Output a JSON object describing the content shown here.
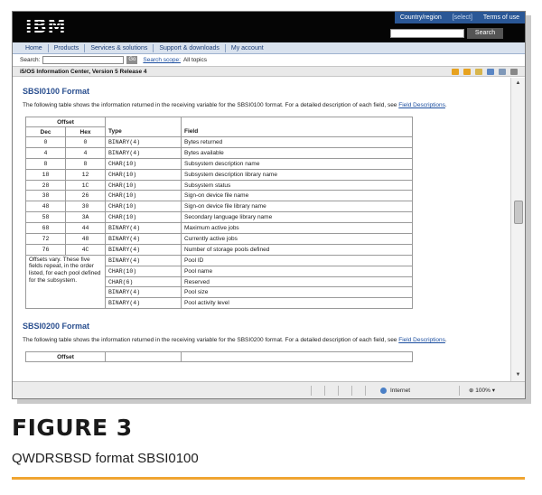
{
  "header": {
    "logo_text": "IBM",
    "links": [
      "Country/region",
      "[select]",
      "Terms of use"
    ],
    "search_button": "Search"
  },
  "nav": {
    "items": [
      "Home",
      "Products",
      "Services & solutions",
      "Support & downloads",
      "My account"
    ]
  },
  "search_bar": {
    "label": "Search:",
    "go_label": "Go",
    "scope_label": "Search scope:",
    "scope_value": "All topics"
  },
  "toolbar": {
    "breadcrumb": "i5/OS Information Center, Version 5 Release 4"
  },
  "section1": {
    "title": "SBSI0100 Format",
    "desc_text": "The following table shows the information returned in the receiving variable for the SBSI0100 format. For a detailed description of each field, see",
    "desc_link": "Field Descriptions",
    "desc_end": "."
  },
  "table": {
    "group_header": "Offset",
    "headers": [
      "Dec",
      "Hex",
      "Type",
      "Field"
    ],
    "rows": [
      {
        "dec": "0",
        "hex": "0",
        "type": "BINARY(4)",
        "field": "Bytes returned"
      },
      {
        "dec": "4",
        "hex": "4",
        "type": "BINARY(4)",
        "field": "Bytes available"
      },
      {
        "dec": "8",
        "hex": "8",
        "type": "CHAR(10)",
        "field": "Subsystem description name"
      },
      {
        "dec": "18",
        "hex": "12",
        "type": "CHAR(10)",
        "field": "Subsystem description library name"
      },
      {
        "dec": "28",
        "hex": "1C",
        "type": "CHAR(10)",
        "field": "Subsystem status"
      },
      {
        "dec": "38",
        "hex": "26",
        "type": "CHAR(10)",
        "field": "Sign-on device file name"
      },
      {
        "dec": "48",
        "hex": "30",
        "type": "CHAR(10)",
        "field": "Sign-on device file library name"
      },
      {
        "dec": "58",
        "hex": "3A",
        "type": "CHAR(10)",
        "field": "Secondary language library name"
      },
      {
        "dec": "68",
        "hex": "44",
        "type": "BINARY(4)",
        "field": "Maximum active jobs"
      },
      {
        "dec": "72",
        "hex": "48",
        "type": "BINARY(4)",
        "field": "Currently active jobs"
      },
      {
        "dec": "76",
        "hex": "4C",
        "type": "BINARY(4)",
        "field": "Number of storage pools defined"
      }
    ],
    "repeat_note": "Offsets vary. These five fields repeat, in the order listed, for each pool defined for the subsystem.",
    "repeat_rows": [
      {
        "type": "BINARY(4)",
        "field": "Pool ID"
      },
      {
        "type": "CHAR(10)",
        "field": "Pool name"
      },
      {
        "type": "CHAR(6)",
        "field": "Reserved"
      },
      {
        "type": "BINARY(4)",
        "field": "Pool size"
      },
      {
        "type": "BINARY(4)",
        "field": "Pool activity level"
      }
    ]
  },
  "section2": {
    "title": "SBSI0200 Format",
    "desc_text": "The following table shows the information returned in the receiving variable for the SBSI0200 format. For a detailed description of each field, see",
    "desc_link": "Field Descriptions",
    "desc_end": ".",
    "table_group_header": "Offset"
  },
  "statusbar": {
    "zone": "Internet",
    "zoom": "100%"
  },
  "caption": {
    "label": "FIGURE 3",
    "text": "QWDRSBSD format SBSI0100"
  },
  "colors": {
    "accent_blue": "#2a4f8f",
    "caption_rule": "#f0a531"
  }
}
